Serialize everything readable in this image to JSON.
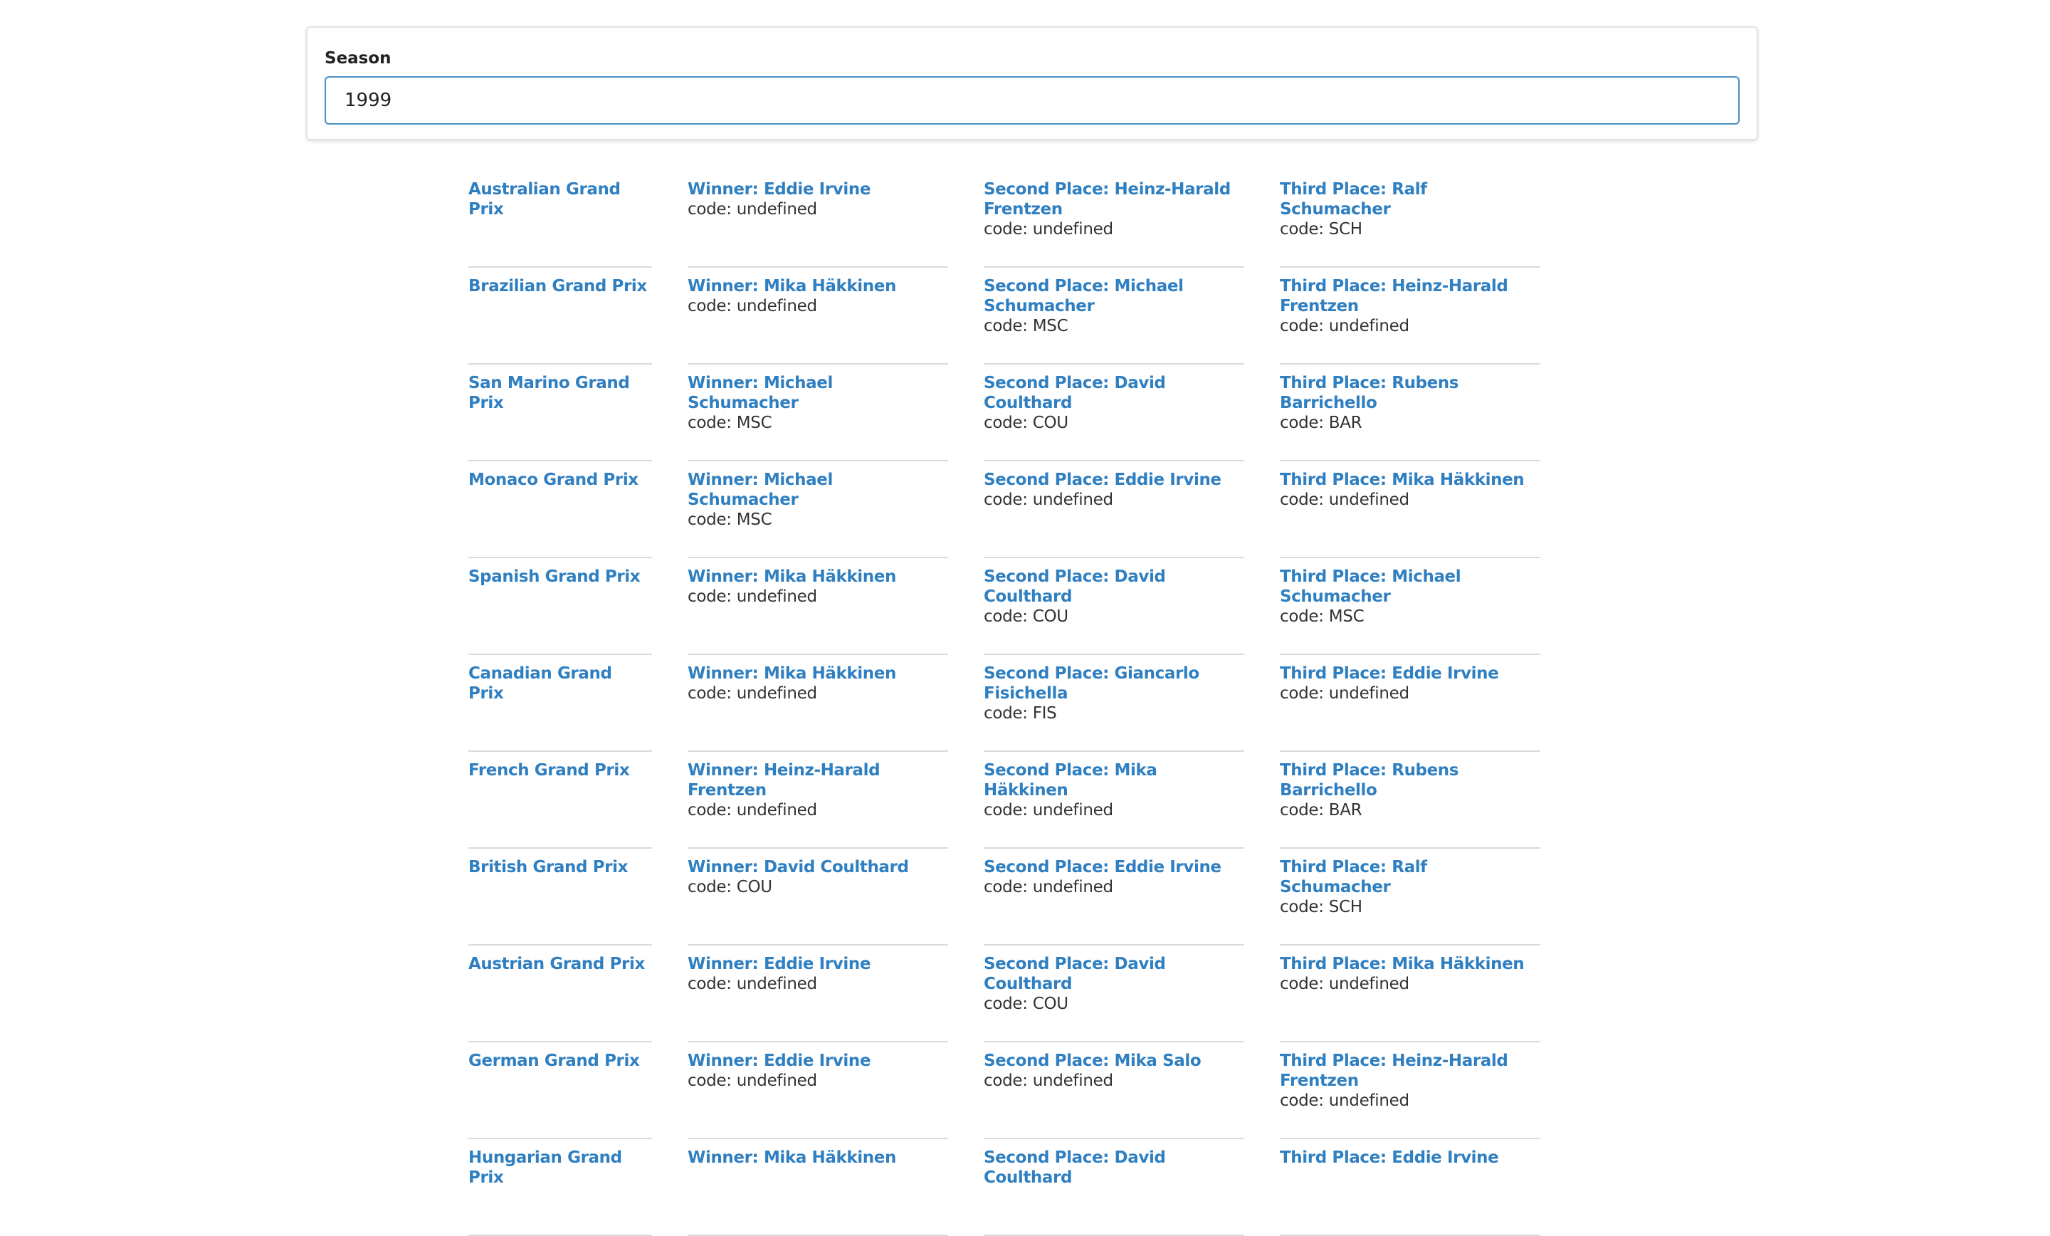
{
  "season": {
    "label": "Season",
    "value": "1999"
  },
  "races": [
    {
      "race": "Australian Grand Prix",
      "winner": "Winner: Eddie Irvine",
      "winner_code": "code: undefined",
      "second": "Second Place: Heinz-Harald Frentzen",
      "second_code": "code: undefined",
      "third": "Third Place: Ralf Schumacher",
      "third_code": "code: SCH"
    },
    {
      "race": "Brazilian Grand Prix",
      "winner": "Winner: Mika Häkkinen",
      "winner_code": "code: undefined",
      "second": "Second Place: Michael Schumacher",
      "second_code": "code: MSC",
      "third": "Third Place: Heinz-Harald Frentzen",
      "third_code": "code: undefined"
    },
    {
      "race": "San Marino Grand Prix",
      "winner": "Winner: Michael Schumacher",
      "winner_code": "code: MSC",
      "second": "Second Place: David Coulthard",
      "second_code": "code: COU",
      "third": "Third Place: Rubens Barrichello",
      "third_code": "code: BAR"
    },
    {
      "race": "Monaco Grand Prix",
      "winner": "Winner: Michael Schumacher",
      "winner_code": "code: MSC",
      "second": "Second Place: Eddie Irvine",
      "second_code": "code: undefined",
      "third": "Third Place: Mika Häkkinen",
      "third_code": "code: undefined"
    },
    {
      "race": "Spanish Grand Prix",
      "winner": "Winner: Mika Häkkinen",
      "winner_code": "code: undefined",
      "second": "Second Place: David Coulthard",
      "second_code": "code: COU",
      "third": "Third Place: Michael Schumacher",
      "third_code": "code: MSC"
    },
    {
      "race": "Canadian Grand Prix",
      "winner": "Winner: Mika Häkkinen",
      "winner_code": "code: undefined",
      "second": "Second Place: Giancarlo Fisichella",
      "second_code": "code: FIS",
      "third": "Third Place: Eddie Irvine",
      "third_code": "code: undefined"
    },
    {
      "race": "French Grand Prix",
      "winner": "Winner: Heinz-Harald Frentzen",
      "winner_code": "code: undefined",
      "second": "Second Place: Mika Häkkinen",
      "second_code": "code: undefined",
      "third": "Third Place: Rubens Barrichello",
      "third_code": "code: BAR"
    },
    {
      "race": "British Grand Prix",
      "winner": "Winner: David Coulthard",
      "winner_code": "code: COU",
      "second": "Second Place: Eddie Irvine",
      "second_code": "code: undefined",
      "third": "Third Place: Ralf Schumacher",
      "third_code": "code: SCH"
    },
    {
      "race": "Austrian Grand Prix",
      "winner": "Winner: Eddie Irvine",
      "winner_code": "code: undefined",
      "second": "Second Place: David Coulthard",
      "second_code": "code: COU",
      "third": "Third Place: Mika Häkkinen",
      "third_code": "code: undefined"
    },
    {
      "race": "German Grand Prix",
      "winner": "Winner: Eddie Irvine",
      "winner_code": "code: undefined",
      "second": "Second Place: Mika Salo",
      "second_code": "code: undefined",
      "third": "Third Place: Heinz-Harald Frentzen",
      "third_code": "code: undefined"
    },
    {
      "race": "Hungarian Grand Prix",
      "winner": "Winner: Mika Häkkinen",
      "winner_code": "",
      "second": "Second Place: David Coulthard",
      "second_code": "",
      "third": "Third Place: Eddie Irvine",
      "third_code": ""
    }
  ],
  "colors": {
    "link": "#2f7fc1",
    "input_border": "#4a90c2",
    "divider": "#dadada"
  }
}
